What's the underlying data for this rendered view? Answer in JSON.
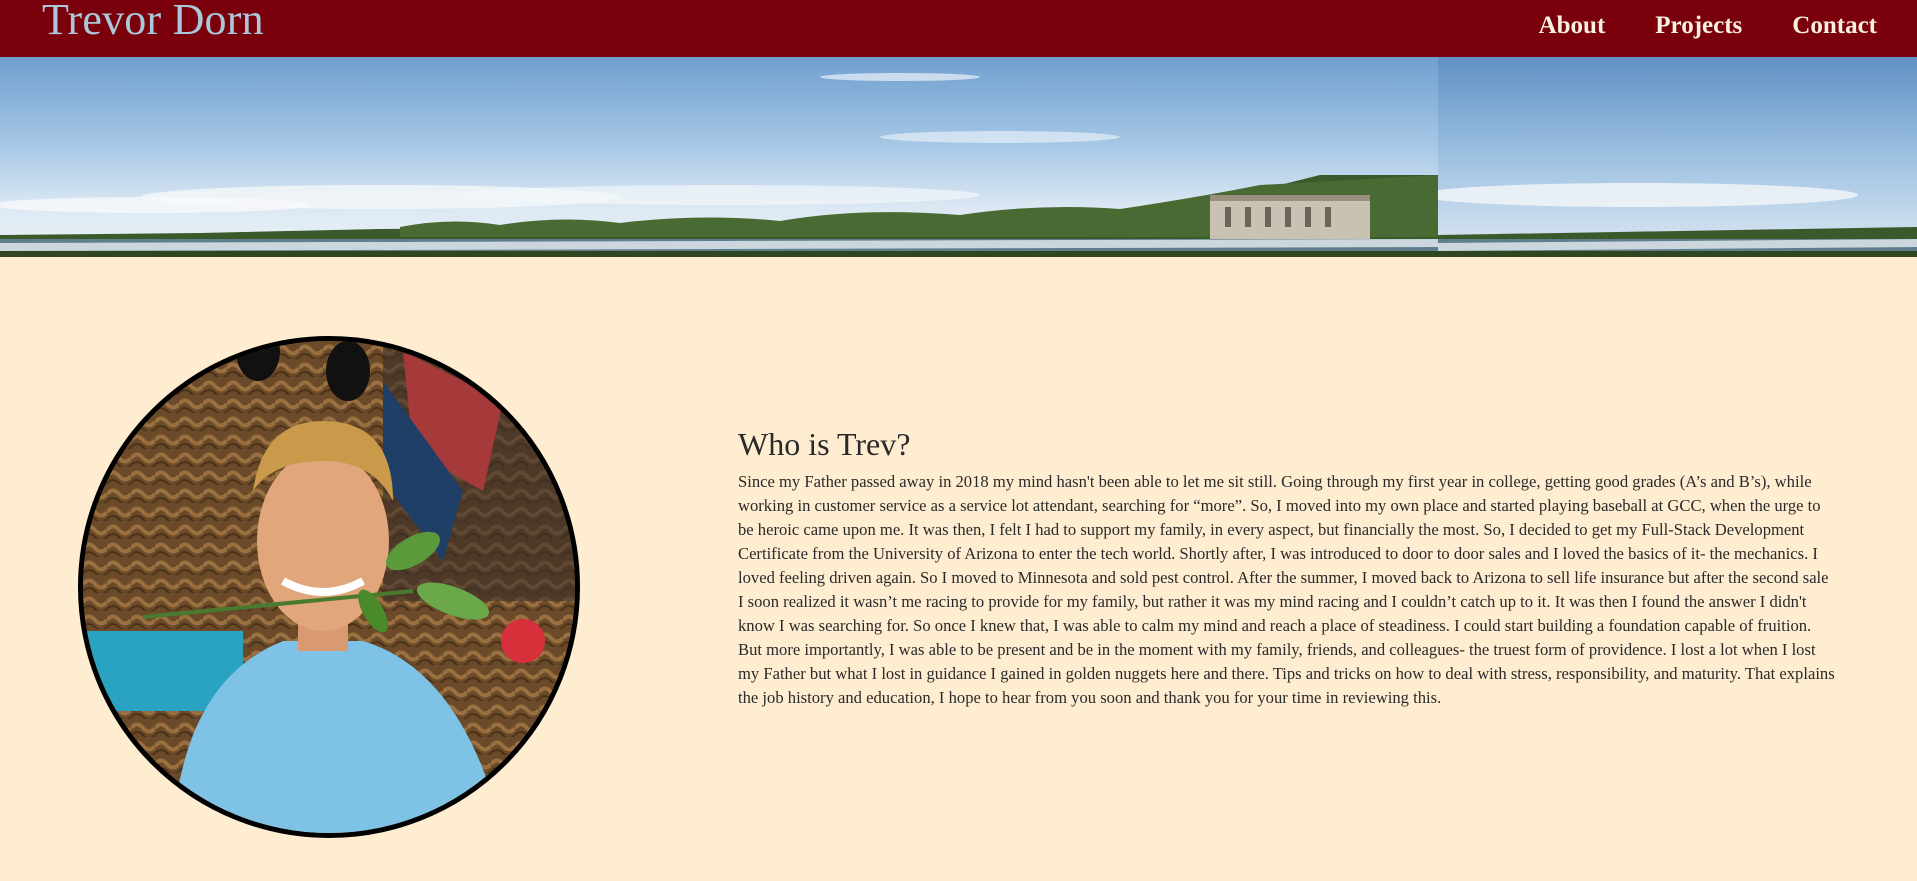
{
  "header": {
    "brand": "Trevor Dorn",
    "nav": [
      {
        "label": "About"
      },
      {
        "label": "Projects"
      },
      {
        "label": "Contact"
      }
    ]
  },
  "banner": {
    "image": "river-landscape-banner"
  },
  "profile": {
    "image": "profile-photo"
  },
  "about": {
    "heading": "Who is Trev?",
    "body": "Since my Father passed away in 2018 my mind hasn't been able to let me sit still. Going through my first year in college, getting good grades (A’s and B’s), while working in customer service as a service lot attendant, searching for “more”. So, I moved into my own place and started playing baseball at GCC, when the urge to be heroic came upon me. It was then, I felt I had to support my family, in every aspect, but financially the most. So, I decided to get my Full-Stack Development Certificate from the University of Arizona to enter the tech world. Shortly after, I was introduced to door to door sales and I loved the basics of it- the mechanics. I loved feeling driven again. So I moved to Minnesota and sold pest control. After the summer, I moved back to Arizona to sell life insurance but after the second sale I soon realized it wasn’t me racing to provide for my family, but rather it was my mind racing and I couldn’t catch up to it. It was then I found the answer I didn't know I was searching for. So once I knew that, I was able to calm my mind and reach a place of steadiness. I could start building a foundation capable of fruition. But more importantly, I was able to be present and be in the moment with my family, friends, and colleagues- the truest form of providence. I lost a lot when I lost my Father but what I lost in guidance I gained in golden nuggets here and there. Tips and tricks on how to deal with stress, responsibility, and maturity. That explains the job history and education, I hope to hear from you soon and thank you for your time in reviewing this."
  },
  "colors": {
    "header_bg": "#7a000b",
    "brand_text": "#a9c8da",
    "nav_text": "#f7f1e1",
    "page_bg": "#ffedd1",
    "body_text": "#2a2a2a"
  }
}
